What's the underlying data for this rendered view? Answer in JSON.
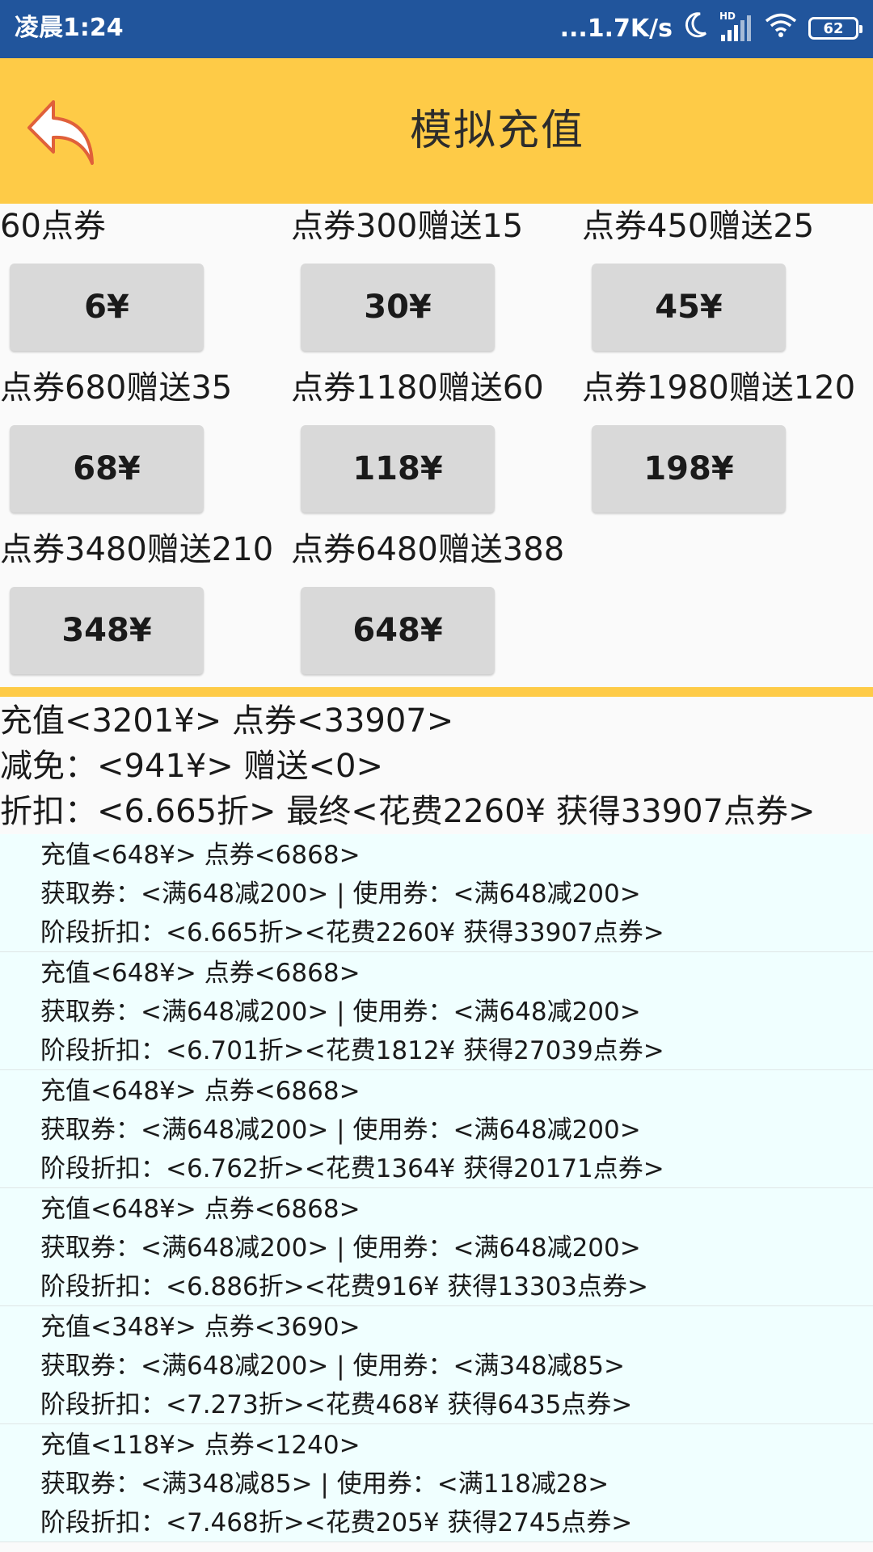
{
  "status_bar": {
    "time": "凌晨1:24",
    "network_speed": "...1.7K/s",
    "hd_label": "HD",
    "battery": "62"
  },
  "header": {
    "title": "模拟充值",
    "back_icon": "back-arrow-icon"
  },
  "packages": [
    {
      "label": "60点券",
      "price": "6¥"
    },
    {
      "label": "点券300赠送15",
      "price": "30¥"
    },
    {
      "label": "点券450赠送25",
      "price": "45¥"
    },
    {
      "label": "点券680赠送35",
      "price": "68¥"
    },
    {
      "label": "点券1180赠送60",
      "price": "118¥"
    },
    {
      "label": "点券1980赠送120",
      "price": "198¥"
    },
    {
      "label": "点券3480赠送210",
      "price": "348¥"
    },
    {
      "label": "点券6480赠送388",
      "price": "648¥"
    }
  ],
  "summary": {
    "line1": "充值<3201¥> 点券<33907>",
    "line2": "减免：<941¥> 赠送<0>",
    "line3": "折扣：<6.665折> 最终<花费2260¥ 获得33907点券>"
  },
  "stages": [
    {
      "recharge": "充值<648¥> 点券<6868>",
      "coupons": "获取券：<满648减200> | 使用券：<满648减200>",
      "discount": "阶段折扣：<6.665折><花费2260¥ 获得33907点券>"
    },
    {
      "recharge": "充值<648¥> 点券<6868>",
      "coupons": "获取券：<满648减200> | 使用券：<满648减200>",
      "discount": "阶段折扣：<6.701折><花费1812¥ 获得27039点券>"
    },
    {
      "recharge": "充值<648¥> 点券<6868>",
      "coupons": "获取券：<满648减200> | 使用券：<满648减200>",
      "discount": "阶段折扣：<6.762折><花费1364¥ 获得20171点券>"
    },
    {
      "recharge": "充值<648¥> 点券<6868>",
      "coupons": "获取券：<满648减200> | 使用券：<满648减200>",
      "discount": "阶段折扣：<6.886折><花费916¥ 获得13303点券>"
    },
    {
      "recharge": "充值<348¥> 点券<3690>",
      "coupons": "获取券：<满648减200> | 使用券：<满348减85>",
      "discount": "阶段折扣：<7.273折><花费468¥ 获得6435点券>"
    },
    {
      "recharge": "充值<118¥> 点券<1240>",
      "coupons": "获取券：<满348减85> | 使用券：<满118减28>",
      "discount": "阶段折扣：<7.468折><花费205¥ 获得2745点券>"
    }
  ],
  "colors": {
    "status_bar": "#21559c",
    "header": "#fecb47",
    "button": "#d9d9d9",
    "stage_bg": "#f0ffff"
  }
}
